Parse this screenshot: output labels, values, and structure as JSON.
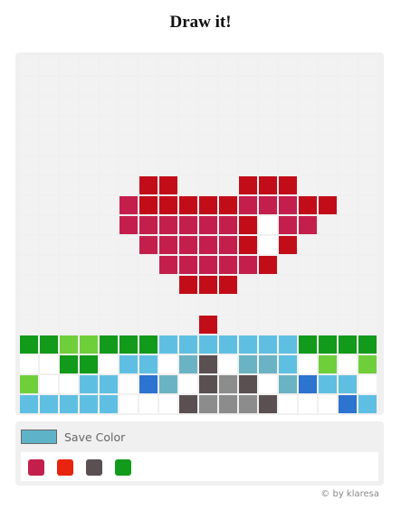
{
  "page": {
    "title": "Draw it!",
    "credit": "© by klaresa"
  },
  "controls": {
    "save_label": "Save Color",
    "current_color": "#5fb3c9"
  },
  "colors": {
    "_": "#ffffff",
    "e": "#f2f2f2",
    "r": "#c20d19",
    "p": "#c41f4c",
    "g": "#129a1a",
    "l": "#6fcf3a",
    "c": "#5fbfe3",
    "t": "#6ab3c4",
    "b": "#2c74cf",
    "d": "#5a5052",
    "m": "#8c8c8c"
  },
  "grid": [
    "eeeeeeeeeeeeeeeeeeeeeeeeeeeeee",
    "eeeeeeeeeeeeeeeeeeee",
    "eeeeeeeeeeeeeeeeeeee",
    "eeeeeeeeeeeeeeeeeeee",
    "eeeeeeeeeeeeeeeeeeee",
    "eeeeeeeeeeeeeeeeeeee",
    "eeeeeerreeerrreeeeee",
    "eeeeeprrrrrppprreeee",
    "eeeeeppppppr_ppeeeee",
    "eeeeeepppppr_reeeeee",
    "eeeeeeepppppreeeeeee",
    "eeeeeeeerrreeeeeeeee",
    "eeeeeeeeeeeeeeeeeeee",
    "eeeeeeeeereeeeeeeeee",
    "ggllgggcccccccggggg",
    "__gg_cc_td_ttc_l_l",
    "l__cc_bt_dmd_tbcc_g",
    "ccccc___dmmmd___bc_",
    "tbbt___dmmmmmd___cc",
    "b______dm__mm____tbb"
  ],
  "palette": [
    {
      "color": "#c41f4c"
    },
    {
      "color": "#e8230e"
    },
    {
      "color": "#5a5052"
    },
    {
      "color": "#129a1a"
    }
  ]
}
